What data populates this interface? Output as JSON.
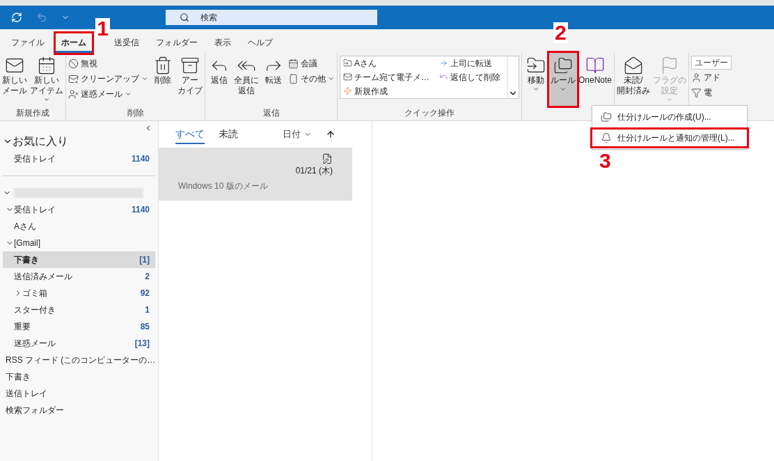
{
  "title_bar": {
    "search_placeholder": "検索"
  },
  "tabs": [
    {
      "label": "ファイル",
      "selected": false
    },
    {
      "label": "ホーム",
      "selected": true
    },
    {
      "label": "送受信",
      "selected": false
    },
    {
      "label": "フォルダー",
      "selected": false
    },
    {
      "label": "表示",
      "selected": false
    },
    {
      "label": "ヘルプ",
      "selected": false
    }
  ],
  "ribbon": [
    {
      "label": "新規作成",
      "items": [
        {
          "kind": "large",
          "lines": [
            "新しい",
            "メール"
          ],
          "dropdown": false,
          "pressed": false,
          "disabled": false
        },
        {
          "kind": "large",
          "lines": [
            "新しい",
            "アイテム"
          ],
          "dropdown": true,
          "pressed": false,
          "disabled": false
        }
      ]
    },
    {
      "label": "削除",
      "items": [
        {
          "kind": "small",
          "lines": [
            "無視"
          ],
          "dropdown": false
        },
        {
          "kind": "small",
          "lines": [
            "クリーンアップ"
          ],
          "dropdown": true
        },
        {
          "kind": "small",
          "lines": [
            "迷惑メール"
          ],
          "dropdown": true
        },
        {
          "kind": "large",
          "lines": [
            "削除"
          ],
          "dropdown": false,
          "pressed": false,
          "disabled": false
        },
        {
          "kind": "large",
          "lines": [
            "アー",
            "カイブ"
          ],
          "dropdown": false,
          "pressed": false,
          "disabled": false
        }
      ]
    },
    {
      "label": "返信",
      "items": [
        {
          "kind": "large",
          "lines": [
            "返信"
          ],
          "dropdown": false,
          "pressed": false,
          "disabled": false
        },
        {
          "kind": "large",
          "lines": [
            "全員に",
            "返信"
          ],
          "dropdown": false,
          "pressed": false,
          "disabled": false
        },
        {
          "kind": "large",
          "lines": [
            "転送"
          ],
          "dropdown": false,
          "pressed": false,
          "disabled": false
        },
        {
          "kind": "small",
          "lines": [
            "会議"
          ],
          "dropdown": false
        },
        {
          "kind": "small",
          "lines": [
            "その他"
          ],
          "dropdown": true
        }
      ]
    },
    {
      "label": "クイック操作",
      "items": [
        {
          "kind": "gallery",
          "entries": [
            "Aさん",
            "チーム宛て電子メ…",
            "新規作成",
            "上司に転送",
            "返信して削除"
          ]
        }
      ]
    },
    {
      "items": [
        {
          "kind": "large",
          "lines": [
            "移動"
          ],
          "dropdown": true,
          "pressed": false,
          "disabled": false
        },
        {
          "kind": "large",
          "lines": [
            "ルール"
          ],
          "dropdown": true,
          "pressed": true,
          "disabled": false
        },
        {
          "kind": "large",
          "lines": [
            "OneNote"
          ],
          "dropdown": false,
          "pressed": false,
          "disabled": false
        }
      ]
    },
    {
      "items": [
        {
          "kind": "large",
          "lines": [
            "未読/",
            "開封済み"
          ],
          "dropdown": false,
          "pressed": false,
          "disabled": false
        },
        {
          "kind": "large",
          "lines": [
            "フラグの",
            "設定"
          ],
          "dropdown": true,
          "pressed": false,
          "disabled": true
        }
      ]
    },
    {
      "items": [
        {
          "kind": "field",
          "placeholder": "ユーザー"
        },
        {
          "kind": "small",
          "lines": [
            "アド"
          ],
          "dropdown": false
        },
        {
          "kind": "small",
          "lines": [
            "電"
          ],
          "dropdown": false
        }
      ]
    }
  ],
  "rules_menu": [
    {
      "label": "仕分けルールの作成(U)..."
    },
    {
      "label": "仕分けルールと通知の管理(L)..."
    }
  ],
  "sidebar": {
    "favorites": {
      "label": "お気に入り",
      "expanded": true,
      "children": [
        {
          "label": "受信トレイ",
          "count": "1140",
          "selected": false
        }
      ]
    },
    "account": {
      "expanded": true,
      "children": [
        {
          "label": "受信トレイ",
          "count": "1140",
          "selected": false,
          "expanded": true,
          "children": [
            {
              "label": "Aさん",
              "selected": false
            }
          ]
        },
        {
          "label": "[Gmail]",
          "selected": false,
          "expanded": true,
          "children": [
            {
              "label": "下書き",
              "count": "[1]",
              "selected": true
            },
            {
              "label": "送信済みメール",
              "count": "2",
              "selected": false
            },
            {
              "label": "ゴミ箱",
              "count": "92",
              "selected": false,
              "expanded": false
            },
            {
              "label": "スター付き",
              "count": "1",
              "selected": false
            },
            {
              "label": "重要",
              "count": "85",
              "selected": false
            },
            {
              "label": "迷惑メール",
              "count": "[13]",
              "selected": false
            }
          ]
        },
        {
          "label": "RSS フィード (このコンピューターの…",
          "selected": false
        },
        {
          "label": "下書き",
          "selected": false
        },
        {
          "label": "送信トレイ",
          "selected": false
        },
        {
          "label": "検索フォルダー",
          "selected": false
        }
      ]
    }
  },
  "message_list": {
    "filters": [
      {
        "label": "すべて",
        "selected": true
      },
      {
        "label": "未読",
        "selected": false
      }
    ],
    "sort": "日付",
    "messages": [
      {
        "date": "01/21 (木)",
        "preview": "Windows 10 版のメール",
        "selected": true
      }
    ]
  },
  "annotations": [
    {
      "label": "1"
    },
    {
      "label": "2"
    },
    {
      "label": "3"
    }
  ]
}
